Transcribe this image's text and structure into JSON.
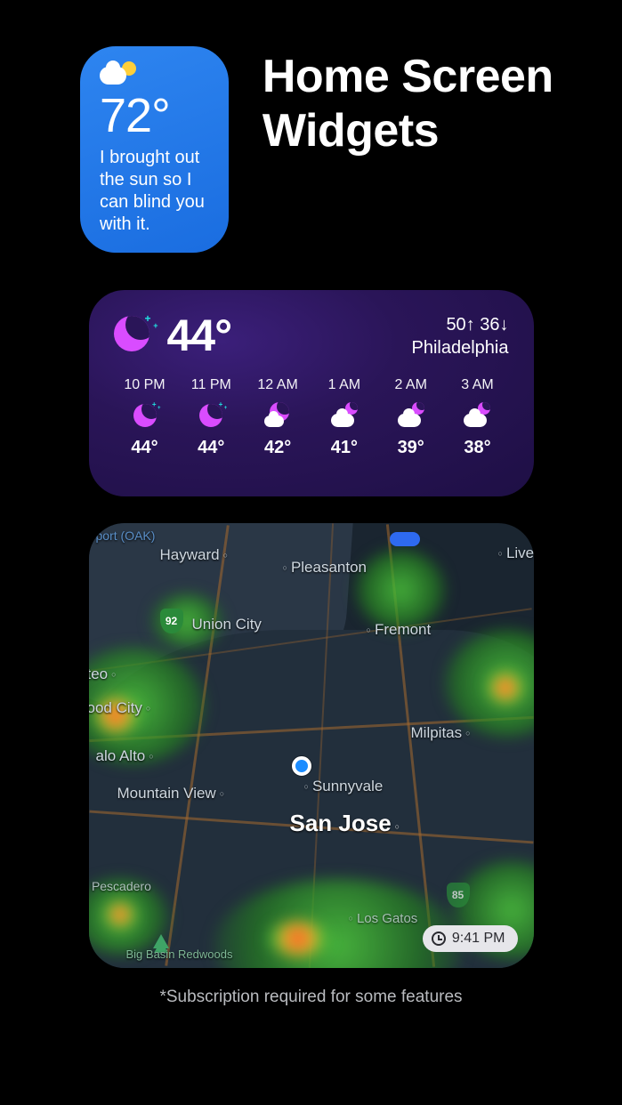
{
  "title": "Home Screen Widgets",
  "blue": {
    "temp": "72°",
    "quip": "I brought out the sun so I can blind you with it."
  },
  "purple": {
    "current_temp": "44°",
    "high": "50",
    "low": "36",
    "location": "Philadelphia",
    "hours": [
      {
        "label": "10 PM",
        "temp": "44°",
        "icon": "moon-full"
      },
      {
        "label": "11 PM",
        "temp": "44°",
        "icon": "moon-full"
      },
      {
        "label": "12 AM",
        "temp": "42°",
        "icon": "moon-cloud"
      },
      {
        "label": "1 AM",
        "temp": "41°",
        "icon": "cloud-moon"
      },
      {
        "label": "2 AM",
        "temp": "39°",
        "icon": "cloud-moon"
      },
      {
        "label": "3 AM",
        "temp": "38°",
        "icon": "cloud-moon"
      }
    ]
  },
  "map": {
    "time": "9:41 PM",
    "shields": [
      "92",
      "85"
    ],
    "oak_label": "port (OAK)",
    "cities": [
      "Hayward",
      "Pleasanton",
      "Live",
      "Union City",
      "Fremont",
      "teo",
      "ood City",
      "Milpitas",
      "alo Alto",
      "Mountain View",
      "Sunnyvale",
      "San Jose",
      "Pescadero",
      "Los Gatos",
      "Big Basin Redwoods"
    ]
  },
  "footer": "*Subscription required for some features"
}
